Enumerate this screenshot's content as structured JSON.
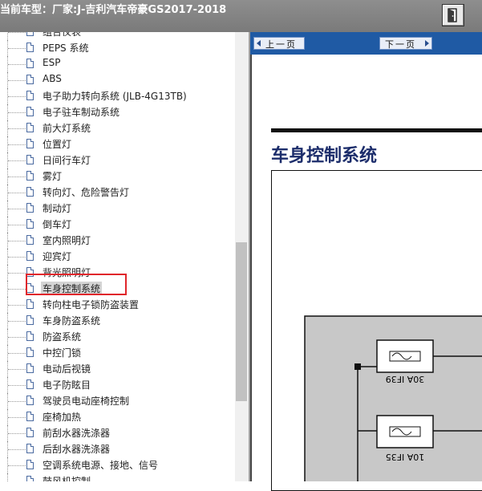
{
  "header": {
    "title": "当前车型：厂家:J-吉利汽车帝豪GS2017-2018",
    "exit_icon": "exit-door-icon"
  },
  "tree": {
    "items": [
      {
        "label": "组合仪表"
      },
      {
        "label": "PEPS 系统"
      },
      {
        "label": "ESP"
      },
      {
        "label": "ABS"
      },
      {
        "label": "电子助力转向系统 (JLB-4G13TB)"
      },
      {
        "label": "电子驻车制动系统"
      },
      {
        "label": "前大灯系统"
      },
      {
        "label": "位置灯"
      },
      {
        "label": "日间行车灯"
      },
      {
        "label": "雾灯"
      },
      {
        "label": "转向灯、危险警告灯"
      },
      {
        "label": "制动灯"
      },
      {
        "label": "倒车灯"
      },
      {
        "label": "室内照明灯"
      },
      {
        "label": "迎宾灯"
      },
      {
        "label": "背光照明灯"
      },
      {
        "label": "车身控制系统",
        "selected": true
      },
      {
        "label": "转向柱电子锁防盗装置"
      },
      {
        "label": "车身防盗系统"
      },
      {
        "label": "防盗系统"
      },
      {
        "label": "中控门锁"
      },
      {
        "label": "电动后视镜"
      },
      {
        "label": "电子防眩目"
      },
      {
        "label": "驾驶员电动座椅控制"
      },
      {
        "label": "座椅加热"
      },
      {
        "label": "前刮水器洗涤器"
      },
      {
        "label": "后刮水器洗涤器"
      },
      {
        "label": "空调系统电源、接地、信号"
      },
      {
        "label": "鼓风机控制"
      }
    ]
  },
  "nav": {
    "prev_label": "上一页",
    "next_label": "下一页"
  },
  "document": {
    "title": "车身控制系统",
    "fuses": [
      {
        "label": "30A IF39"
      },
      {
        "label": "10A IF35"
      }
    ]
  },
  "colors": {
    "highlight": "#e0262b",
    "nav_bar": "#1f5aa4",
    "title_text": "#1c2d6b"
  }
}
